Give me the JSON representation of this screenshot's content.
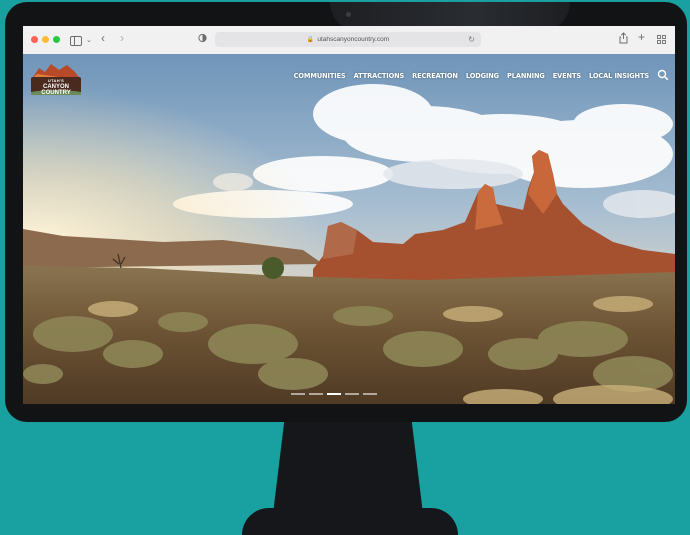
{
  "browser": {
    "url": "utahscanyoncountry.com",
    "back_icon": "chevron-left-icon",
    "forward_icon": "chevron-right-icon",
    "share_icon": "share-icon",
    "new_tab_icon": "plus-icon",
    "tabs_icon": "grid-icon"
  },
  "site": {
    "logo_line1": "UTAH'S",
    "logo_line2": "CANYON COUNTRY",
    "nav": [
      {
        "label": "COMMUNITIES"
      },
      {
        "label": "ATTRACTIONS"
      },
      {
        "label": "RECREATION"
      },
      {
        "label": "LODGING"
      },
      {
        "label": "PLANNING"
      },
      {
        "label": "EVENTS"
      },
      {
        "label": "LOCAL INSIGHTS"
      }
    ],
    "slides": 5,
    "active_slide": 3
  },
  "colors": {
    "background": "#19a1a2",
    "monitor": "#121315"
  }
}
